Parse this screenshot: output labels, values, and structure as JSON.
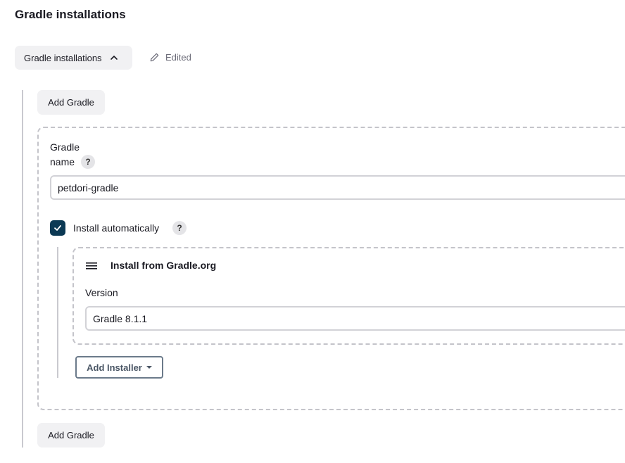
{
  "section": {
    "title": "Gradle installations"
  },
  "collapse": {
    "label": "Gradle installations",
    "icon": "chevron-up-icon"
  },
  "status": {
    "label": "Edited",
    "icon": "pencil-icon"
  },
  "add_gradle_label": "Add Gradle",
  "installation": {
    "name_label_line1": "Gradle",
    "name_label_line2": "name",
    "name_value": "petdori-gradle",
    "install_auto_label": "Install automatically",
    "install_auto_checked": true,
    "help_glyph": "?"
  },
  "installer": {
    "title": "Install from Gradle.org",
    "version_label": "Version",
    "version_value": "Gradle 8.1.1",
    "add_installer_label": "Add Installer"
  },
  "colors": {
    "checkbox": "#0b3954",
    "button_bg": "#f1f1f3",
    "dashed_border": "#c4c4ca"
  }
}
